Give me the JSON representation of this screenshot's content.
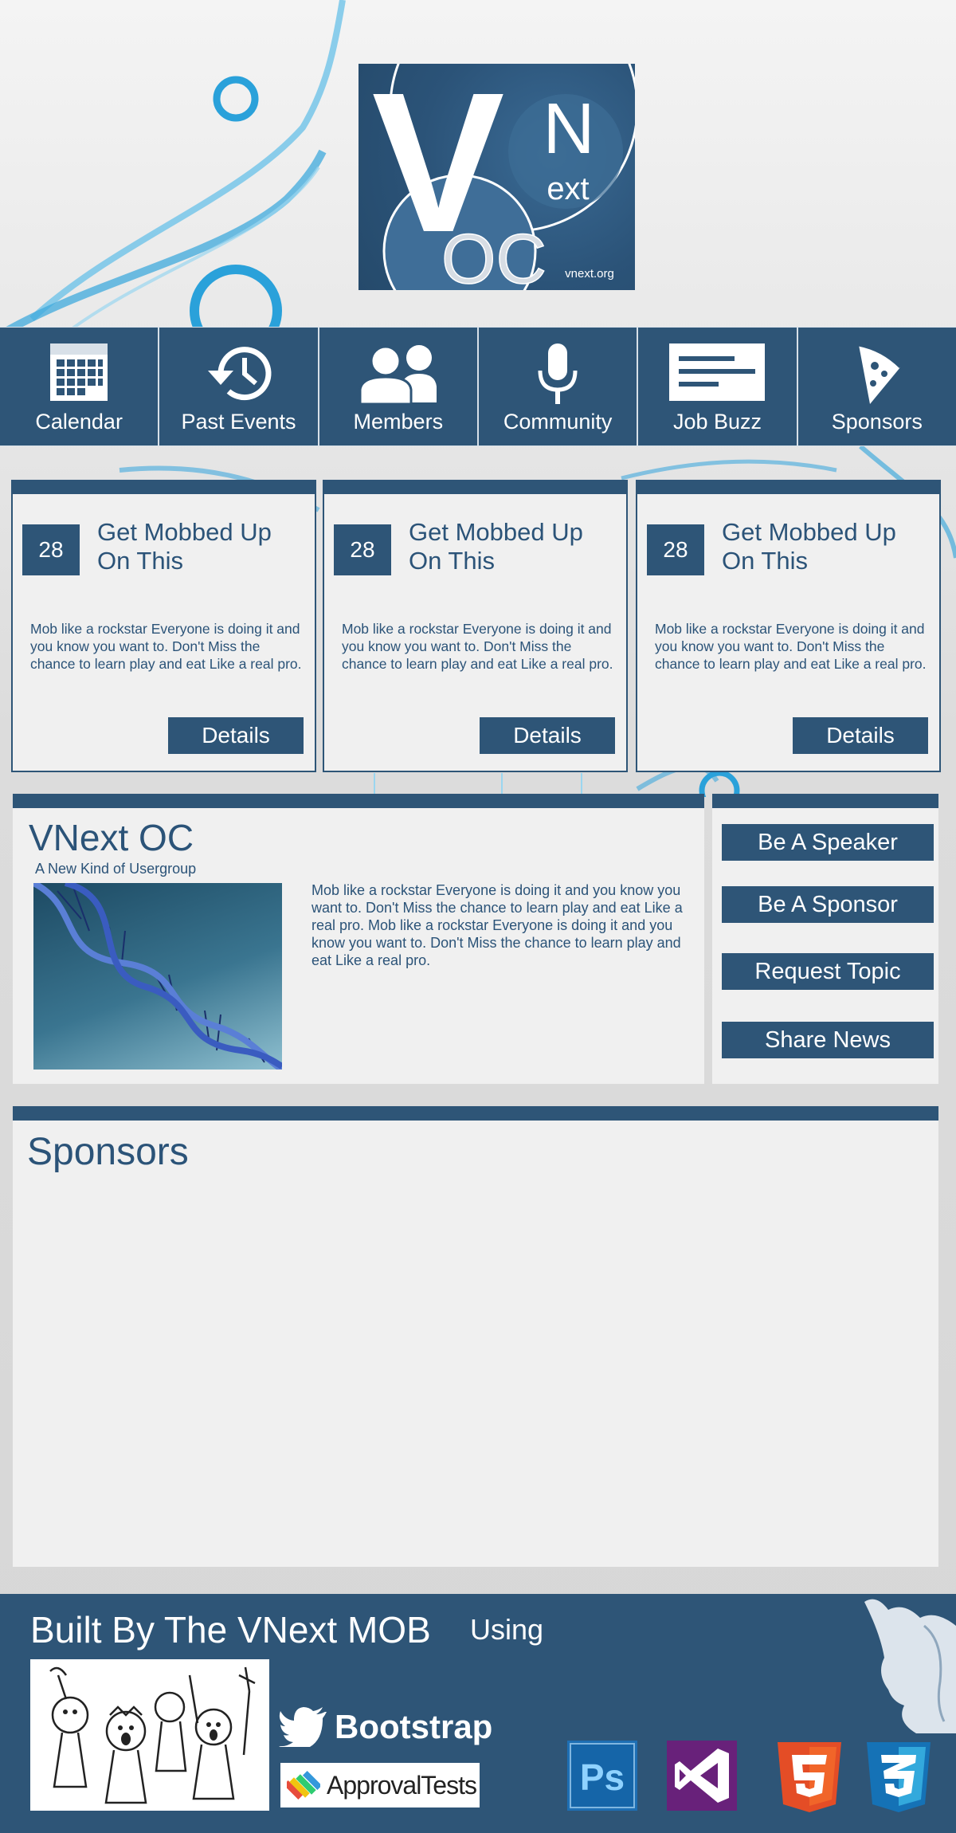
{
  "logo": {
    "big_letter": "V",
    "small_letter": "N",
    "small_suffix": "ext",
    "oc": "OC",
    "url": "vnext.org"
  },
  "nav": {
    "items": [
      {
        "label": "Calendar",
        "icon": "calendar-icon"
      },
      {
        "label": "Past Events",
        "icon": "history-icon"
      },
      {
        "label": "Members",
        "icon": "members-icon"
      },
      {
        "label": "Community",
        "icon": "microphone-icon"
      },
      {
        "label": "Job Buzz",
        "icon": "job-board-icon"
      },
      {
        "label": "Sponsors",
        "icon": "pizza-icon"
      }
    ]
  },
  "events": [
    {
      "date": "28",
      "title": "Get Mobbed Up On This",
      "description": "Mob like a rockstar Everyone is doing it and you know you want to.  Don't Miss the chance to learn play and eat Like a real pro.",
      "button": "Details"
    },
    {
      "date": "28",
      "title": "Get Mobbed Up On This",
      "description": "Mob like a rockstar Everyone is doing it and you know you want to.  Don't Miss the chance to learn play and eat Like a real pro.",
      "button": "Details"
    },
    {
      "date": "28",
      "title": "Get Mobbed Up On This",
      "description": "Mob like a rockstar Everyone is doing it and you know you want to.  Don't Miss the chance to learn play and eat Like a real pro.",
      "button": "Details"
    }
  ],
  "about": {
    "title": "VNext OC",
    "tagline": "A New Kind of Usergroup",
    "text": "Mob like a rockstar Everyone is doing it and you know you want to.  Don't Miss the chance to learn play and eat Like a real pro. Mob like a rockstar Everyone is doing it and you know you want to.  Don't Miss the chance to learn play and eat Like a real pro."
  },
  "actions": {
    "speaker": "Be A Speaker",
    "sponsor": "Be A Sponsor",
    "topic": "Request Topic",
    "news": "Share News"
  },
  "sponsors": {
    "title": "Sponsors"
  },
  "footer": {
    "built_by": "Built By The VNext MOB",
    "using": "Using",
    "bootstrap": "Bootstrap",
    "approval_tests": "ApprovalTests",
    "tools": [
      "photoshop-icon",
      "visual-studio-icon",
      "html5-icon",
      "css3-icon"
    ]
  },
  "colors": {
    "brand": "#2e5577",
    "panel": "#f0f0f0",
    "accent": "#3fb0e0"
  }
}
